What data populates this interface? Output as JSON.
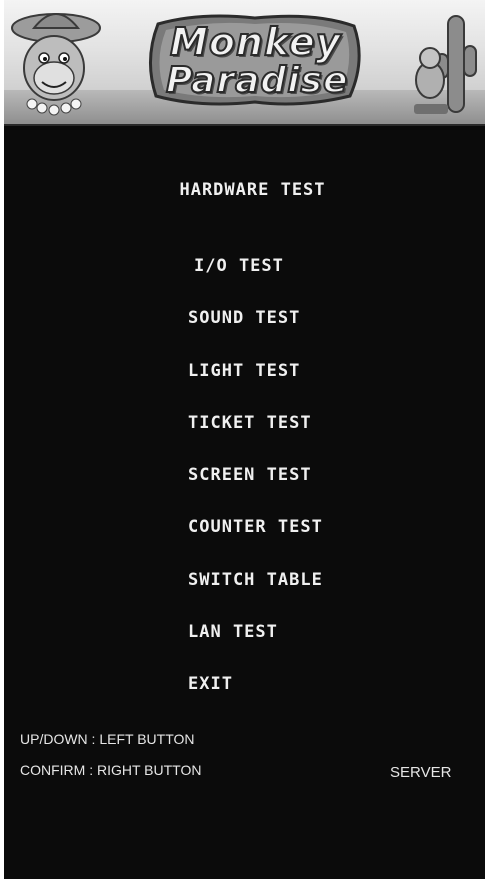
{
  "header": {
    "logo_line1": "Monkey",
    "logo_line2": "Paradise"
  },
  "menu": {
    "title": "HARDWARE TEST",
    "items": [
      "I/O TEST",
      "SOUND TEST",
      "LIGHT TEST",
      "TICKET TEST",
      "SCREEN TEST",
      "COUNTER TEST",
      "SWITCH TABLE",
      "LAN TEST",
      "EXIT"
    ]
  },
  "help": {
    "line1": "UP/DOWN : LEFT BUTTON",
    "line2": "CONFIRM : RIGHT BUTTON",
    "mode": "SERVER"
  },
  "colors": {
    "background": "#0b0b0b",
    "text": "#f0f0f0",
    "banner": "#d8d8d8"
  }
}
